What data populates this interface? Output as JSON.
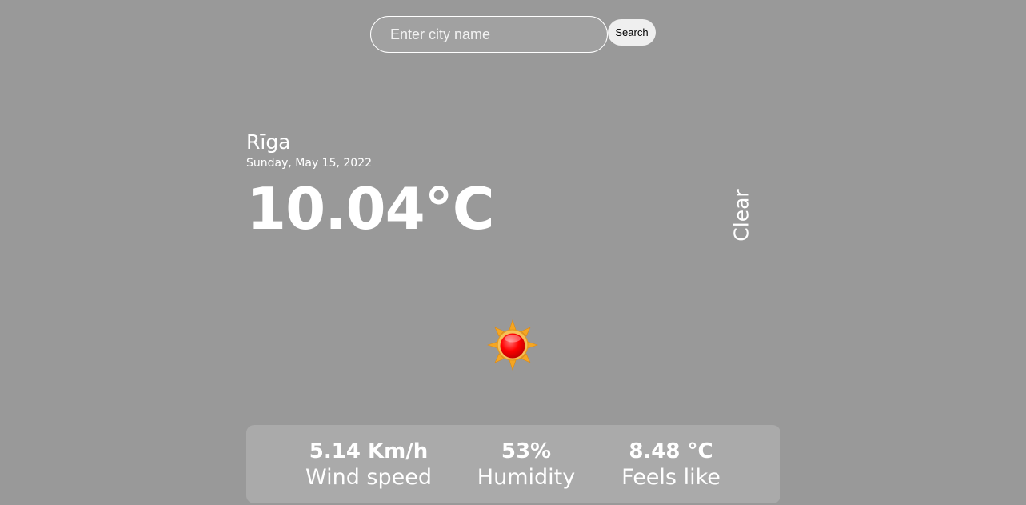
{
  "search": {
    "placeholder": "Enter city name",
    "button_label": "Search"
  },
  "current": {
    "city": "Rīga",
    "date": "Sunday, May 15, 2022",
    "temperature": "10.04°C",
    "condition": "Clear",
    "icon": "sun-icon"
  },
  "stats": [
    {
      "value": "5.14 Km/h",
      "label": "Wind speed"
    },
    {
      "value": "53%",
      "label": "Humidity"
    },
    {
      "value": "8.48 °C",
      "label": "Feels like"
    }
  ],
  "colors": {
    "background": "#999999",
    "card": "#aaaaaa",
    "text": "#ffffff",
    "sun_core": "#ff0000",
    "sun_rays": "#f5a623"
  }
}
